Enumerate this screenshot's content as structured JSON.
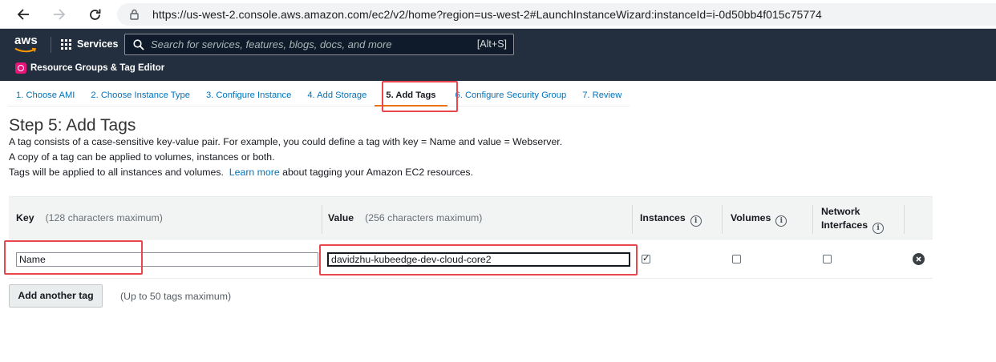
{
  "browser": {
    "url_scheme": "https://",
    "url_host": "us-west-2.console.aws.amazon.com",
    "url_path": "/ec2/v2/home?region=us-west-2#LaunchInstanceWizard:instanceId=i-0d50bb4f015c75774"
  },
  "aws_nav": {
    "logo_text": "aws",
    "services_label": "Services",
    "search_placeholder": "Search for services, features, blogs, docs, and more",
    "search_shortcut": "[Alt+S]",
    "resource_groups_label": "Resource Groups & Tag Editor"
  },
  "wizard": {
    "tabs": [
      {
        "label": "1. Choose AMI"
      },
      {
        "label": "2. Choose Instance Type"
      },
      {
        "label": "3. Configure Instance"
      },
      {
        "label": "4. Add Storage"
      },
      {
        "label": "5. Add Tags",
        "active": true
      },
      {
        "label": "6. Configure Security Group"
      },
      {
        "label": "7. Review"
      }
    ]
  },
  "page": {
    "title": "Step 5: Add Tags",
    "desc_line1": "A tag consists of a case-sensitive key-value pair. For example, you could define a tag with key = Name and value = Webserver.",
    "desc_line2": "A copy of a tag can be applied to volumes, instances or both.",
    "desc_line3_pre": "Tags will be applied to all instances and volumes.",
    "desc_line3_link": "Learn more",
    "desc_line3_post": "about tagging your Amazon EC2 resources."
  },
  "table": {
    "headers": {
      "key": "Key",
      "key_hint": "(128 characters maximum)",
      "value": "Value",
      "value_hint": "(256 characters maximum)",
      "instances": "Instances",
      "volumes": "Volumes",
      "network_line1": "Network",
      "network_line2": "Interfaces",
      "info_glyph": "i"
    },
    "rows": [
      {
        "key": "Name",
        "value": "davidzhu-kubeedge-dev-cloud-core2",
        "instances": true,
        "volumes": false,
        "network_interfaces": false
      }
    ]
  },
  "actions": {
    "add_tag_label": "Add another tag",
    "add_tag_hint": "(Up to 50 tags maximum)"
  },
  "colors": {
    "nav_bg": "#232f3e",
    "link": "#0073bb",
    "highlight": "#e8474d",
    "active_tab_underline": "#ec7211"
  }
}
